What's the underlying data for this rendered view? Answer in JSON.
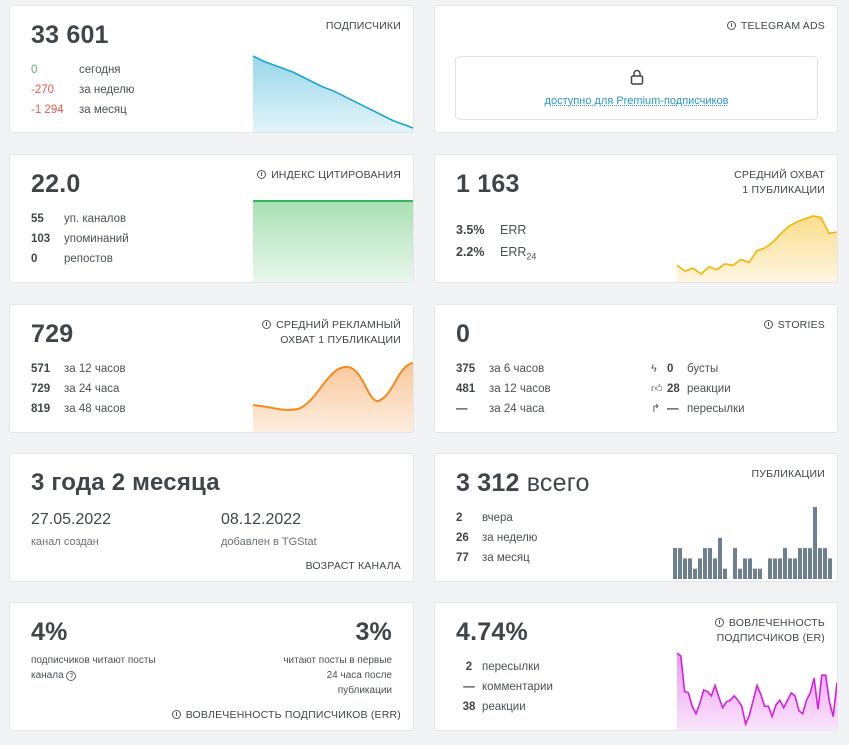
{
  "subscribers": {
    "value": "33 601",
    "title": "ПОДПИСЧИКИ",
    "rows": [
      {
        "value": "0",
        "label": "сегодня"
      },
      {
        "value": "-270",
        "label": "за неделю"
      },
      {
        "value": "-1 294",
        "label": "за месяц"
      }
    ],
    "trend": [
      58,
      54,
      51,
      48,
      45,
      41,
      37,
      33,
      30,
      26,
      22,
      18,
      14,
      10,
      6,
      3,
      0
    ],
    "color": "#1aa5cf"
  },
  "ads": {
    "title": "TELEGRAM ADS",
    "lock_text": "доступно для Premium-подписчиков"
  },
  "citation": {
    "value": "22.0",
    "title": "ИНДЕКС ЦИТИРОВАНИЯ",
    "rows": [
      {
        "value": "55",
        "label": "уп. каналов"
      },
      {
        "value": "103",
        "label": "упоминаний"
      },
      {
        "value": "0",
        "label": "репостов"
      }
    ],
    "color": "#37b45a"
  },
  "reach": {
    "value": "1 163",
    "title_line1": "СРЕДНИЙ ОХВАТ",
    "title_line2": "1 ПУБЛИКАЦИИ",
    "err_value": "3.5%",
    "err_label": "ERR",
    "err24_value": "2.2%",
    "err24_label": "ERR",
    "err24_sub": "24",
    "trend": [
      18,
      14,
      16,
      12,
      17,
      15,
      19,
      18,
      22,
      20,
      28,
      30,
      34,
      40,
      45,
      48,
      50,
      52,
      51,
      40,
      41
    ],
    "color": "#f4b400"
  },
  "ad_reach": {
    "value": "729",
    "title_line1": "СРЕДНИЙ РЕКЛАМНЫЙ",
    "title_line2": "ОХВАТ 1 ПУБЛИКАЦИИ",
    "rows": [
      {
        "value": "571",
        "label": "за 12 часов"
      },
      {
        "value": "729",
        "label": "за 24 часа"
      },
      {
        "value": "819",
        "label": "за 48 часов"
      }
    ],
    "color": "#f28a1c"
  },
  "stories": {
    "value": "0",
    "title": "STORIES",
    "rows": [
      {
        "value": "375",
        "label": "за 6 часов"
      },
      {
        "value": "481",
        "label": "за 12 часов"
      },
      {
        "value": "—",
        "label": "за 24 часа"
      }
    ],
    "right_rows": [
      {
        "icon": "lightning-icon",
        "value": "0",
        "label": "бусты"
      },
      {
        "icon": "thumbs-up-icon",
        "value": "28",
        "label": "реакции"
      },
      {
        "icon": "share-arrow-icon",
        "value": "—",
        "label": "пересылки"
      }
    ]
  },
  "age": {
    "value": "3 года 2 месяца",
    "created_date": "27.05.2022",
    "created_label": "канал создан",
    "added_date": "08.12.2022",
    "added_label": "добавлен в TGStat",
    "footer": "ВОЗРАСТ КАНАЛА"
  },
  "posts": {
    "value": "3 312",
    "value_suffix": "всего",
    "title": "ПУБЛИКАЦИИ",
    "rows": [
      {
        "value": "2",
        "label": "вчера"
      },
      {
        "value": "26",
        "label": "за неделю"
      },
      {
        "value": "77",
        "label": "за месяц"
      }
    ],
    "bars": [
      3,
      3,
      2,
      2,
      1,
      2,
      3,
      3,
      2,
      4,
      1,
      0,
      3,
      1,
      2,
      2,
      1,
      1,
      0,
      2,
      2,
      2,
      3,
      2,
      2,
      3,
      3,
      3,
      7,
      3,
      3,
      2
    ],
    "color": "#6e7f8f"
  },
  "err_card": {
    "value_left": "4%",
    "text_left": "подписчиков читают посты канала",
    "value_right": "3%",
    "text_right": "читают посты в первые 24 часа после публикации",
    "footer": "ВОВЛЕЧЕННОСТЬ ПОДПИСЧИКОВ (ERR)"
  },
  "er_card": {
    "value": "4.74%",
    "title_line1": "ВОВЛЕЧЕННОСТЬ",
    "title_line2": "ПОДПИСЧИКОВ (ER)",
    "rows": [
      {
        "value": "2",
        "label": "пересылки"
      },
      {
        "value": "—",
        "label": "комментарии"
      },
      {
        "value": "38",
        "label": "реакции"
      }
    ],
    "trend": [
      76,
      74,
      50,
      49,
      40,
      35,
      42,
      51,
      50,
      47,
      54,
      46,
      39,
      43,
      44,
      47,
      44,
      40,
      28,
      34,
      44,
      54,
      48,
      40,
      40,
      33,
      41,
      44,
      39,
      44,
      49,
      47,
      37,
      35,
      44,
      49,
      59,
      38,
      61,
      61,
      43,
      33,
      56
    ],
    "color": "#d51ee0"
  }
}
